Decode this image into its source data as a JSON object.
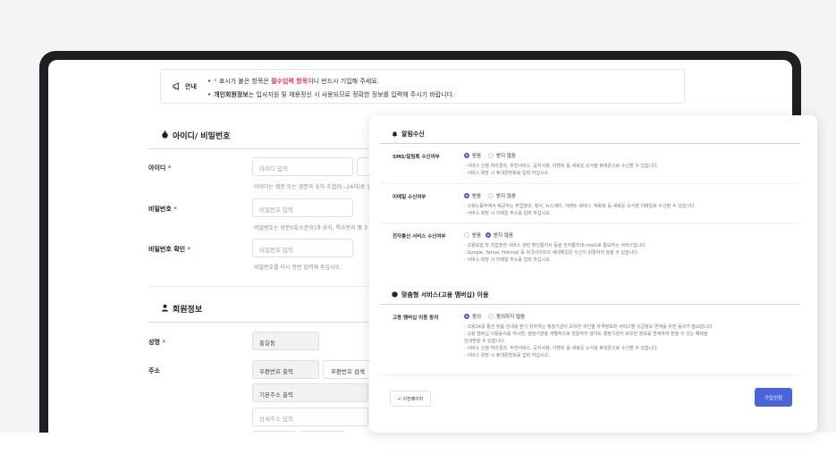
{
  "notice": {
    "label": "안내",
    "line1_prefix": "표시가 붙은 항목은 ",
    "line1_req": "필수입력 항목",
    "line1_suffix": "이니 반드시 기입해 주세요.",
    "line2_bold": "개인회원정보",
    "line2_text": "는 입사지원 및 채용정신 시 사용되므로 정확한 정보를 입력해 주시기 바랍니다."
  },
  "account": {
    "title": "아이디/ 비밀번호",
    "id_label": "아이디",
    "id_placeholder": "아이디 입력",
    "id_help": "아이디는 영문 또는 영문과 숫자 조합(5~24자)로 입",
    "pw_label": "비밀번호",
    "pw_placeholder": "비밀번호 입력",
    "pw_help": "비밀번호는 영문(대/소문자)과 숫자, 특수문자 중 3",
    "pwc_label": "비밀번호 확인",
    "pwc_placeholder": "비밀번호 입력",
    "pwc_help": "비밀번호를 다시 한번 입력해 주십시오."
  },
  "member": {
    "title": "회원정보",
    "name_label": "성명",
    "name_value": "홍길동",
    "address_label": "주소",
    "zip_value": "우편번호 출력",
    "zip_search": "우편번호 검색",
    "addr_base": "기본주소 출력",
    "addr_detail": "상세주소 입력"
  },
  "modal": {
    "section1_title": "알림수신",
    "sms_label": "SMS/알림톡 수신여부",
    "sms_options": [
      "받음",
      "받지 않음"
    ],
    "sms_notes": [
      "- 서비스 신청 처리결과, 추천서비스, 공지사항, 이벤트 등 새로운 소식을 휴대폰으로 수신할 수 있습니다.",
      "- 서비스 희망 시 휴대폰번호를 입력 하십시오."
    ],
    "email_label": "이메일 수신여부",
    "email_options": [
      "받음",
      "받지 않음"
    ],
    "email_notes": [
      "- 고용노동부에서 제공하는 취업정보, 행사, 뉴스레터, 이벤트 세미나, 박람회 등 새로운 소식을 이메일로 수신할 수 있습니다.",
      "- 서비스 희망 시 이메일 주소를 입력 하십시오."
    ],
    "edoc_label": "전자통신 서비스 수신여부",
    "edoc_options": [
      "받음",
      "받지 않음"
    ],
    "edoc_notes": [
      "- 고용보험 및 직업훈련 서비스 관련 확인통지서 등을 전자통지(E-mail)로 통보하는 서비스입니다.",
      "- Google, Yahoo, Hotmail 등 외국사이트의 새내메일은 수신이 원활하지 않을 수 있습니다.",
      "- 서비스 희망 시 이메일 주소를 입력 하십시오."
    ],
    "section2_title": "맞춤형 서비스(고용 멤버십) 이용",
    "member_label": "고용 멤버십 이용 동의",
    "member_options": [
      "동의",
      "동의하지 않음"
    ],
    "member_notes": [
      "- 고용24를 통한 맞춤 안내를 받기 위하여는 행정기관이 보유한 개인별 자격정보와 서비스별 수급정보 연계를 위한 동의가 필요합니다.",
      "- 고용 멤버십 이용동의를 하시면, 행정기관을 개별적으로 방문하지 않아도 행정기관이 보유한 정보를 연계하여 받을 수 있는 혜택을",
      "  안내받을 수 있습니다.",
      "- 서비스 신청 처리결과, 추천서비스, 공지사항, 이벤트 등 새로운 소식을 휴대폰으로 수신할 수 있습니다.",
      "- 서비스 희망 시 휴대폰번호를 입력 하십시오."
    ],
    "prev_button": "< 이전페이지",
    "join_button": "가입신청"
  },
  "required_mark": "*",
  "colors": {
    "accent": "#4a63d8",
    "required": "#e03a55",
    "frame": "#1e1f23"
  }
}
